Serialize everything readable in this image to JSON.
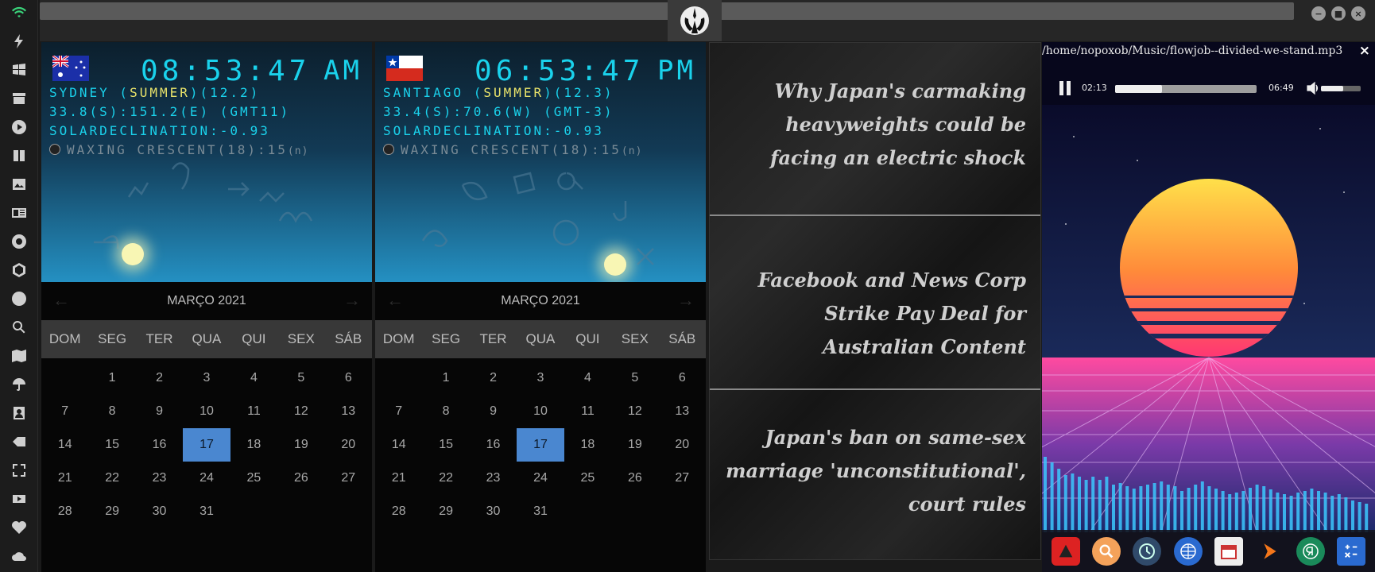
{
  "dock": {
    "icons": [
      "wifi-icon",
      "lightning-icon",
      "windows-icon",
      "drawer-icon",
      "play-circle-icon",
      "book-icon",
      "image-icon",
      "newspaper-icon",
      "settings-gear-icon",
      "hexagon-icon",
      "globe-icon",
      "search-icon",
      "map-icon",
      "umbrella-icon",
      "contact-icon",
      "tag-icon",
      "fullscreen-icon",
      "youtube-icon",
      "heart-icon",
      "cloud-icon"
    ]
  },
  "clocks": [
    {
      "time": "08:53:47",
      "ampm": "AM",
      "city": "SYDNEY",
      "season": "SUMMER",
      "city_code": "(12.2)",
      "coords": "33.8(S):151.2(E) (GMT11)",
      "solar": "SOLARDECLINATION:-0.93",
      "moon": "WAXING CRESCENT(18):15",
      "moon_suffix": "(n)"
    },
    {
      "time": "06:53:47",
      "ampm": "PM",
      "city": "SANTIAGO",
      "season": "SUMMER",
      "city_code": "(12.3)",
      "coords": "33.4(S):70.6(W) (GMT-3)",
      "solar": "SOLARDECLINATION:-0.93",
      "moon": "WAXING CRESCENT(18):15",
      "moon_suffix": "(n)"
    }
  ],
  "calendar": {
    "month_label": "MARÇO 2021",
    "prev": "←",
    "next": "→",
    "weekdays": [
      "DOM",
      "SEG",
      "TER",
      "QUA",
      "QUI",
      "SEX",
      "SÁB"
    ],
    "leading_blanks": 1,
    "days": 31,
    "today": 17
  },
  "news": {
    "headlines": [
      "Why Japan's carmaking heavyweights could be facing an electric shock",
      "Facebook and News Corp Strike Pay Deal for Australian Content",
      "Japan's ban on same-sex marriage 'unconstitutional', court rules"
    ]
  },
  "player": {
    "path": "/home/nopoxob/Music/flowjob--divided-we-stand.mp3",
    "close": "×",
    "current_time": "02:13",
    "total_time": "06:49",
    "progress": 0.33,
    "volume": 0.55
  },
  "tray": {
    "icons": [
      "antivirus-icon",
      "search-magnifier-icon",
      "clock-icon",
      "network-globe-icon",
      "calendar-icon",
      "terminal-arrow-icon",
      "yandex-icon",
      "calculator-icon"
    ]
  }
}
